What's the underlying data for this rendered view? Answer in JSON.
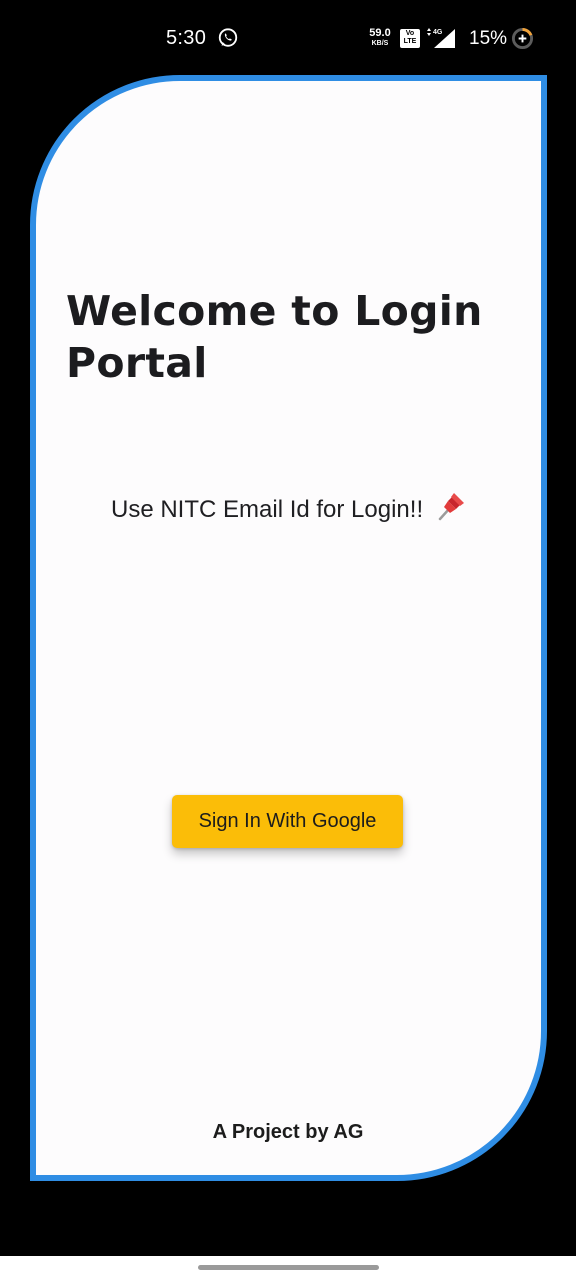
{
  "status_bar": {
    "time": "5:30",
    "notification_icon": "whatsapp-icon",
    "network_speed_value": "59.0",
    "network_speed_unit": "KB/S",
    "volte_top": "Vo",
    "volte_bottom": "LTE",
    "network_type": "4G",
    "battery_percent": "15%",
    "battery_icon": "battery-saver-icon"
  },
  "main": {
    "title": "Welcome to Login Portal",
    "instruction": "Use NITC Email Id for Login!!",
    "instruction_icon": "pushpin-icon",
    "sign_in_button": "Sign In With Google",
    "footer": "A Project by AG"
  },
  "colors": {
    "background": "#000000",
    "card_background": "#fdfcfd",
    "card_border": "#2f8de4",
    "button": "#fbbd08",
    "text": "#1c1c1f"
  },
  "nav_bar": {
    "gesture_handle": "home-indicator"
  }
}
